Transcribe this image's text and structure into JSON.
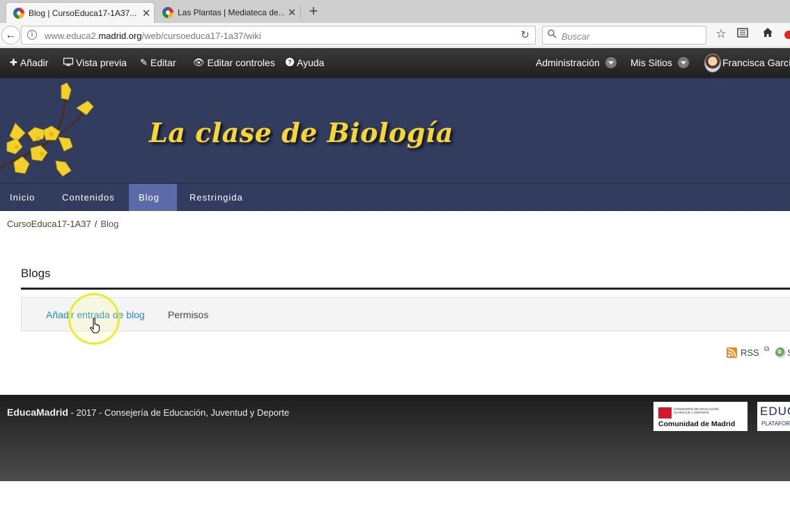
{
  "browser": {
    "tabs": [
      {
        "title": "Blog | CursoEduca17-1A37..."
      },
      {
        "title": "Las Plantas | Mediateca de..."
      }
    ],
    "new_tab": "+",
    "url_prefix": "www.educa2.",
    "url_host": "madrid.org",
    "url_path": "/web/cursoeduca17-1a37/wiki",
    "search_placeholder": "Buscar"
  },
  "dockbar": {
    "add": "Añadir",
    "preview": "Vista previa",
    "edit": "Editar",
    "edit_controls": "Editar controles",
    "help": "Ayuda",
    "admin": "Administración",
    "my_sites": "Mis Sitios",
    "user": "Francisca García"
  },
  "site": {
    "title": "La clase de Biología",
    "nav": [
      "Inicio",
      "Contenidos",
      "Blog",
      "Restringida"
    ],
    "nav_selected": "Blog"
  },
  "breadcrumb": [
    "CursoEduca17-1A37",
    "Blog"
  ],
  "blogs": {
    "title": "Blogs",
    "add_entry": "Añadir entrada de blog",
    "permissions": "Permisos",
    "rss": "RSS"
  },
  "footer": {
    "brand": "EducaMadrid",
    "text": " - 2017 - Consejería de Educación, Juventud y Deporte",
    "cm_small": "CONSEJERÍA DE EDUCACIÓN, JUVENTUD Y DEPORTE",
    "cm_big": "Comunidad de Madrid",
    "edu_big": "EDUCA",
    "edu_small": "PLATAFORMA"
  },
  "colors": {
    "banner": "#323c5f",
    "nav_selected": "#5b6aa9",
    "title_yellow": "#f7d532",
    "link_blue": "#2189c8"
  }
}
